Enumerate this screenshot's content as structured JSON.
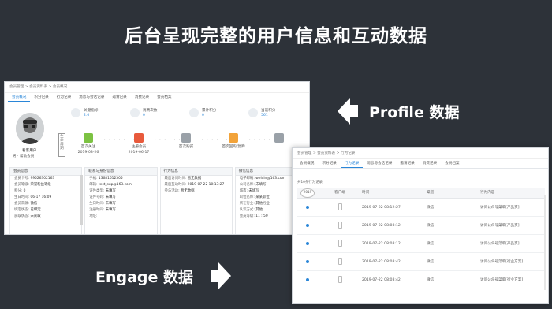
{
  "headline": "后台呈现完整的用户信息和互动数据",
  "callouts": {
    "profile": "Profile 数据",
    "engage": "Engage 数据"
  },
  "window1": {
    "breadcrumb": "会员管理 > 会员资料表 > 会员概况",
    "tabs": [
      "会员概况",
      "积分记录",
      "行为记录",
      "消息与会话记录",
      "邀请记录",
      "消费记录",
      "会员档案"
    ],
    "active_tab": 0,
    "user": {
      "name": "看客用户",
      "line": "男 · 帮助会员"
    },
    "stats": [
      {
        "label": "关键指标",
        "value": "2.0"
      },
      {
        "label": "消费次数",
        "value": "0"
      },
      {
        "label": "累计积分",
        "value": "0"
      },
      {
        "label": "当前积分",
        "value": "561"
      }
    ],
    "vertical_label": "生命周期",
    "timeline": [
      {
        "label": "首次关注",
        "date": "2019-03-26",
        "color": "#7cc242"
      },
      {
        "label": "注册会员",
        "date": "2019-06-17",
        "color": "#e85a3c"
      },
      {
        "label": "首次购买",
        "date": "",
        "color": "#9aa1a8"
      },
      {
        "label": "首次回购/复购",
        "date": "",
        "color": "#f2a33a"
      },
      {
        "label": "",
        "date": "",
        "color": "#9aa1a8"
      }
    ],
    "panels": [
      {
        "title": "会员信息",
        "rows": [
          {
            "k": "会员卡号:",
            "v": "99526302163"
          },
          {
            "k": "会员等级:",
            "v": "荣誉粉丝等级"
          },
          {
            "k": "积分:",
            "v": "0"
          },
          {
            "k": "生日时间:",
            "v": "06-17 16:09"
          },
          {
            "k": "会员来源:",
            "v": "微信"
          },
          {
            "k": "绑定状态:",
            "v": "已绑定"
          },
          {
            "k": "获取状态:",
            "v": "未获取"
          }
        ]
      },
      {
        "title": "联系与身份信息",
        "rows": [
          {
            "k": "手机:",
            "v": "13681612305"
          },
          {
            "k": "邮箱:",
            "v": "test_sup@163.com"
          },
          {
            "k": "证件类型:",
            "v": "未填写"
          },
          {
            "k": "证件号码:",
            "v": "未填写"
          },
          {
            "k": "生日时间:",
            "v": "未填写"
          },
          {
            "k": "注册时间:",
            "v": "未填写"
          },
          {
            "k": "地址:",
            "v": ""
          }
        ]
      },
      {
        "title": "行为信息",
        "rows": [
          {
            "k": "最后访问时间:",
            "v": "暂无数据"
          },
          {
            "k": "最后互动时间:",
            "v": "2019-07-22 10:13:27"
          },
          {
            "k": "参与活动:",
            "v": "暂无数据"
          }
        ]
      },
      {
        "title": "微信信息",
        "rows": [
          {
            "k": "电子邮箱:",
            "v": "weixin@163.com"
          },
          {
            "k": "公司名称:",
            "v": "未填写"
          },
          {
            "k": "城市:",
            "v": "未填写"
          },
          {
            "k": "职位名称:",
            "v": "某某职位"
          },
          {
            "k": "所在行业:",
            "v": "其他行业"
          },
          {
            "k": "认识方式:",
            "v": "其他"
          },
          {
            "k": "会员等级:",
            "v": "11 : 50"
          }
        ]
      }
    ]
  },
  "window2": {
    "breadcrumb": "会员管理 > 会员资料表 > 行为记录",
    "tabs": [
      "会员概况",
      "积分记录",
      "行为记录",
      "消息与会话记录",
      "邀请记录",
      "消费记录",
      "会员档案"
    ],
    "active_tab": 2,
    "note": "共10条行为记录",
    "year": "2019",
    "columns": [
      "",
      "客户端",
      "时间",
      "渠道",
      "行为内容"
    ],
    "rows": [
      {
        "time": "2019-07-22 08:12:27",
        "channel": "微信",
        "content": "访问公众号菜单[产品页]"
      },
      {
        "time": "2019-07-22 08:08:12",
        "channel": "微信",
        "content": "访问公众号菜单[产品页]"
      },
      {
        "time": "2019-07-22 08:08:12",
        "channel": "微信",
        "content": "访问公众号菜单[产品页]"
      },
      {
        "time": "2019-07-22 08:08:42",
        "channel": "微信",
        "content": "访问公众号菜单[行业方案]"
      },
      {
        "time": "2019-07-22 08:08:42",
        "channel": "微信",
        "content": "访问公众号菜单[行业方案]"
      }
    ]
  }
}
